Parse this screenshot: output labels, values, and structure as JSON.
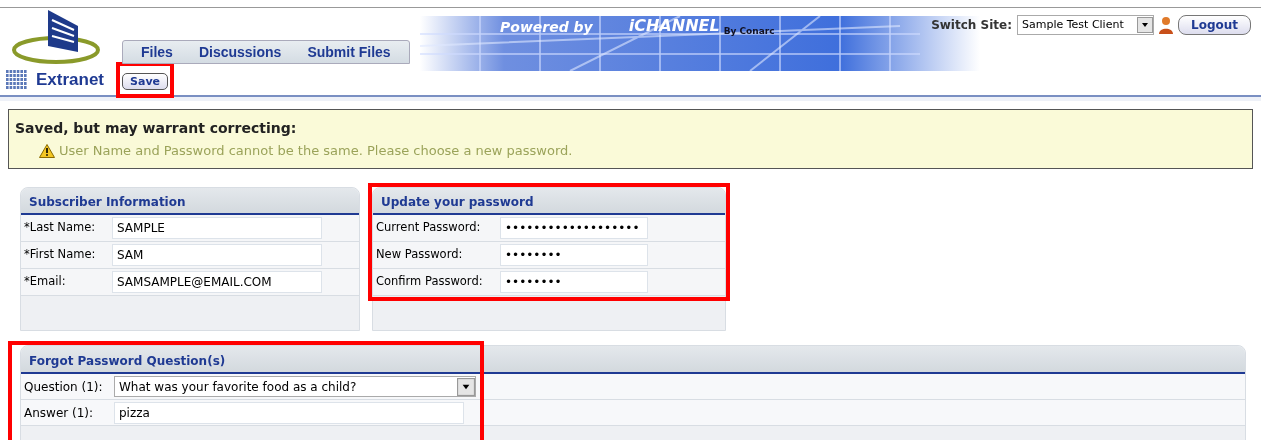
{
  "header": {
    "powered_by": "Powered by",
    "brand": "iCHANNEL",
    "brand_sub": "By Conarc",
    "tabs": [
      {
        "label": "Files"
      },
      {
        "label": "Discussions"
      },
      {
        "label": "Submit Files"
      }
    ],
    "switch_site": {
      "label": "Switch Site:",
      "value": "Sample Test Client"
    },
    "logout": "Logout"
  },
  "toolbar": {
    "title": "Extranet",
    "save": {
      "label": "Save",
      "highlighted": true
    }
  },
  "message": {
    "title": "Saved, but may warrant correcting:",
    "text": "User Name and Password cannot be the same. Please choose a new password."
  },
  "subscriber": {
    "title": "Subscriber Information",
    "highlighted": false,
    "fields": [
      {
        "label": "*Last Name:",
        "value": "SAMPLE"
      },
      {
        "label": "*First Name:",
        "value": "SAM"
      },
      {
        "label": "*Email:",
        "value": "SAMSAMPLE@EMAIL.COM"
      }
    ]
  },
  "password": {
    "title": "Update your password",
    "highlighted": true,
    "fields": [
      {
        "label": "Current Password:",
        "value": "•••••••••••••••••••"
      },
      {
        "label": "New Password:",
        "value": "••••••••"
      },
      {
        "label": "Confirm Password:",
        "value": "••••••••"
      }
    ]
  },
  "forgot": {
    "title": "Forgot Password Question(s)",
    "highlighted": true,
    "fields": [
      {
        "kind": "select",
        "label": "Question (1):",
        "value": "What was your favorite food as a child?"
      },
      {
        "kind": "text",
        "label": "Answer (1):",
        "value": "pizza"
      }
    ]
  }
}
